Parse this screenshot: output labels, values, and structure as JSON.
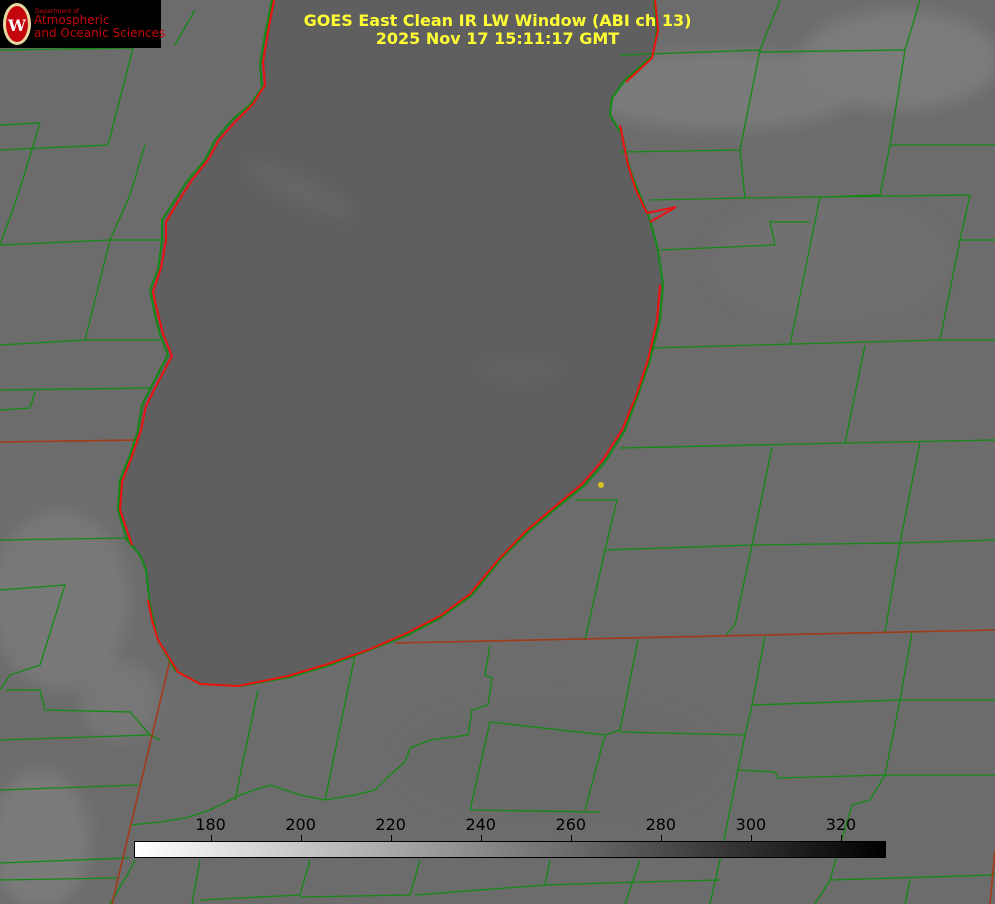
{
  "logo": {
    "dept": "Department of",
    "line1": "Atmospheric",
    "line2": "and Oceanic Sciences"
  },
  "title": {
    "line1": "GOES East Clean IR LW Window (ABI ch 13)",
    "line2": "2025 Nov 17 15:11:17 GMT"
  },
  "colorbar": {
    "min": 163,
    "max": 330,
    "ticks": [
      {
        "value": 180,
        "label": "180"
      },
      {
        "value": 200,
        "label": "200"
      },
      {
        "value": 220,
        "label": "220"
      },
      {
        "value": 240,
        "label": "240"
      },
      {
        "value": 260,
        "label": "260"
      },
      {
        "value": 280,
        "label": "280"
      },
      {
        "value": 300,
        "label": "300"
      },
      {
        "value": 320,
        "label": "320"
      }
    ],
    "colors": {
      "low": "#ffffff",
      "high": "#000000"
    }
  },
  "map_colors": {
    "county_lines": "#138a13",
    "state_lines": "#a33a1a",
    "lake_outline": "#ee1111",
    "marker": "#d8c020",
    "lake_fill": "#5e5e5e",
    "land_fill": "#6b6b6b"
  }
}
